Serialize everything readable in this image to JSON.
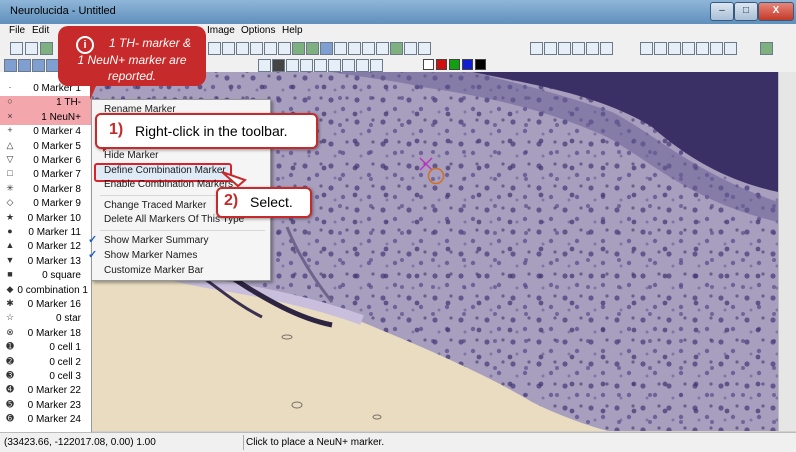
{
  "window": {
    "title": "Neurolucida - Untitled",
    "min": "–",
    "max": "□",
    "close": "X"
  },
  "menubar": {
    "items": [
      "File",
      "Edit",
      "Image",
      "Options",
      "Help"
    ]
  },
  "toolbar": {
    "line_type": "User Line"
  },
  "sidebar": {
    "markers": [
      {
        "symbol": "·",
        "label": "0 Marker 1"
      },
      {
        "symbol": "○",
        "label": "1 TH-"
      },
      {
        "symbol": "×",
        "label": "1 NeuN+"
      },
      {
        "symbol": "+",
        "label": "0 Marker 4"
      },
      {
        "symbol": "△",
        "label": "0 Marker 5"
      },
      {
        "symbol": "▽",
        "label": "0 Marker 6"
      },
      {
        "symbol": "□",
        "label": "0 Marker 7"
      },
      {
        "symbol": "✳",
        "label": "0 Marker 8"
      },
      {
        "symbol": "◇",
        "label": "0 Marker 9"
      },
      {
        "symbol": "★",
        "label": "0 Marker 10"
      },
      {
        "symbol": "●",
        "label": "0 Marker 11"
      },
      {
        "symbol": "▲",
        "label": "0 Marker 12"
      },
      {
        "symbol": "▼",
        "label": "0 Marker 13"
      },
      {
        "symbol": "■",
        "label": "0 square"
      },
      {
        "symbol": "◆",
        "label": "0 combination 1"
      },
      {
        "symbol": "✱",
        "label": "0 Marker 16"
      },
      {
        "symbol": "☆",
        "label": "0 star"
      },
      {
        "symbol": "⊗",
        "label": "0 Marker 18"
      },
      {
        "symbol": "➊",
        "label": "0 cell 1"
      },
      {
        "symbol": "➋",
        "label": "0 cell 2"
      },
      {
        "symbol": "➌",
        "label": "0 cell 3"
      },
      {
        "symbol": "➍",
        "label": "0 Marker 22"
      },
      {
        "symbol": "➎",
        "label": "0 Marker 23"
      },
      {
        "symbol": "➏",
        "label": "0 Marker 24"
      }
    ]
  },
  "context_menu": {
    "items": [
      {
        "label": "Rename Marker",
        "checked": false
      },
      {
        "label": "Hide Marker",
        "checked": false
      },
      {
        "label": "Define Combination Marker",
        "checked": false
      },
      {
        "label": "Enable Combination Markers",
        "checked": false
      },
      {
        "label": "Change Traced Marker",
        "checked": false
      },
      {
        "label": "Delete All Markers Of This Type",
        "checked": false
      },
      {
        "label": "Show Marker Summary",
        "checked": true
      },
      {
        "label": "Show Marker Names",
        "checked": true
      },
      {
        "label": "Customize Marker Bar",
        "checked": false
      }
    ],
    "check_glyph": "✓"
  },
  "callouts": {
    "info": {
      "icon": "i",
      "lines": [
        "1 TH- marker &",
        "1 NeuN+ marker are",
        "reported."
      ]
    },
    "step1": {
      "number": "1)",
      "text": "Right-click in the toolbar."
    },
    "step2": {
      "number": "2)",
      "text": "Select."
    }
  },
  "status": {
    "coordinates": "(33423.66, -122017.08, 0.00) 1.00",
    "message": "Click to place a NeuN+ marker."
  },
  "colors": {
    "accent": "#c62a2a",
    "highlight": "#f3a7ad",
    "tissue": "#a79fbd",
    "white_matter": "#e8dcc0"
  }
}
